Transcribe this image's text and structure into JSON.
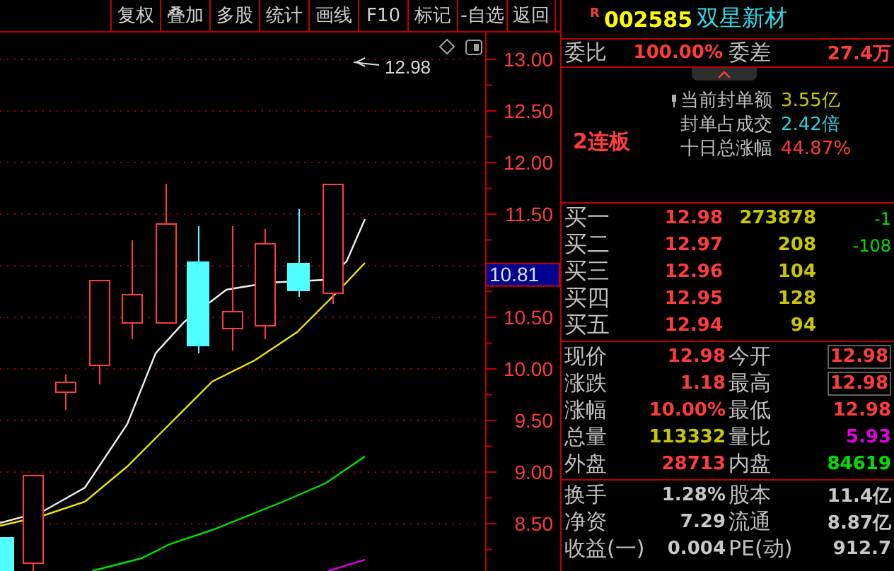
{
  "toolbar": {
    "buttons": [
      "复权",
      "叠加",
      "多股",
      "统计",
      "画线",
      "F10",
      "标记",
      "-自选",
      "返回"
    ]
  },
  "chart": {
    "price_labels": [
      "13.00",
      "12.50",
      "12.00",
      "11.50",
      "10.50",
      "10.00",
      "9.50",
      "9.00",
      "8.50"
    ],
    "high_note": "12.98",
    "current_marker": "10.81"
  },
  "quote_header": {
    "flag": "R",
    "code": "002585",
    "name": "双星新材"
  },
  "ratio_row": {
    "label": "委比",
    "value": "100.00%",
    "label2": "委差",
    "value2": "27.4万"
  },
  "seal_info": {
    "badge": "2连板",
    "lines": [
      {
        "label": "当前封单额",
        "value": "3.55亿",
        "color": "#c8c800"
      },
      {
        "label": "封单占成交",
        "value": "2.42倍",
        "color": "#30d0e0"
      },
      {
        "label": "十日总涨幅",
        "value": "44.87%",
        "color": "#ff3c3c"
      }
    ]
  },
  "bids": [
    {
      "label": "买一",
      "price": "12.98",
      "volume": "273878",
      "change": "-1"
    },
    {
      "label": "买二",
      "price": "12.97",
      "volume": "208",
      "change": "-108"
    },
    {
      "label": "买三",
      "price": "12.96",
      "volume": "104"
    },
    {
      "label": "买四",
      "price": "12.95",
      "volume": "128"
    },
    {
      "label": "买五",
      "price": "12.94",
      "volume": "94"
    }
  ],
  "quotes": [
    {
      "label": "现价",
      "value": "12.98",
      "color": "#ff3c3c",
      "boxed": false
    },
    {
      "label": "今开",
      "value": "12.98",
      "color": "#ff3c3c",
      "boxed": true
    },
    {
      "label": "涨跌",
      "value": "1.18",
      "color": "#ff3c3c",
      "boxed": false
    },
    {
      "label": "最高",
      "value": "12.98",
      "color": "#ff3c3c",
      "boxed": true
    },
    {
      "label": "涨幅",
      "value": "10.00%",
      "color": "#ff3c3c",
      "boxed": false
    },
    {
      "label": "最低",
      "value": "12.98",
      "color": "#ff3c3c",
      "boxed": false
    },
    {
      "label": "总量",
      "value": "113332",
      "color": "#c8c800",
      "boxed": false
    },
    {
      "label": "量比",
      "value": "5.93",
      "color": "#e000e0",
      "boxed": false
    },
    {
      "label": "外盘",
      "value": "28713",
      "color": "#ff3c3c",
      "boxed": false
    },
    {
      "label": "内盘",
      "value": "84619",
      "color": "#00e000",
      "boxed": false
    }
  ],
  "fundamentals": [
    {
      "label": "换手",
      "value": "1.28%",
      "label2": "股本",
      "value2": "11.4亿"
    },
    {
      "label": "净资",
      "value": "7.29",
      "label2": "流通",
      "value2": "8.87亿"
    },
    {
      "label": "收益(一)",
      "value": "0.004",
      "label2": "PE(动)",
      "value2": "912.7"
    }
  ]
}
